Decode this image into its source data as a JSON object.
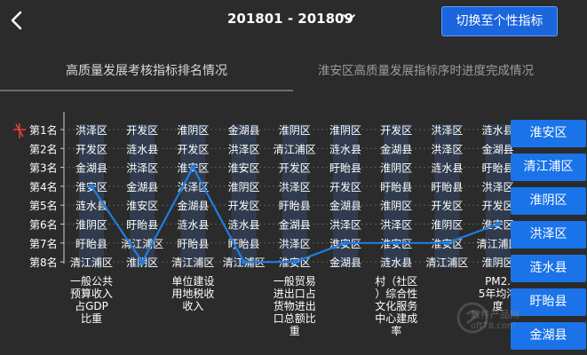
{
  "header": {
    "period": "201801 - 201809",
    "switch_label": "切换至个性指标"
  },
  "tabs": [
    {
      "label": "高质量发展考核指标排名情况",
      "active": true
    },
    {
      "label": "淮安区高质量发展指标序时进度完成情况",
      "active": false
    }
  ],
  "chart_data": {
    "type": "line",
    "rank_labels": [
      "第1名",
      "第2名",
      "第3名",
      "第4名",
      "第5名",
      "第6名",
      "第7名",
      "第8名"
    ],
    "columns": [
      {
        "indicator": "一般公共预算收入占GDP比重",
        "ranking": [
          "洪泽区",
          "开发区",
          "金湖县",
          "淮安区",
          "涟水县",
          "淮阴区",
          "盱眙县",
          "清江浦区"
        ]
      },
      {
        "indicator": "",
        "ranking": [
          "开发区",
          "涟水县",
          "洪泽区",
          "金湖县",
          "淮安区",
          "盱眙县",
          "清江浦区",
          "淮阴区"
        ]
      },
      {
        "indicator": "单位建设用地税收收入",
        "ranking": [
          "淮阴区",
          "开发区",
          "淮安区",
          "洪泽区",
          "金湖县",
          "涟水县",
          "盱眙县",
          "清江浦区"
        ]
      },
      {
        "indicator": "",
        "ranking": [
          "金湖县",
          "洪泽区",
          "淮安区",
          "淮阴区",
          "开发区",
          "涟水县",
          "盱眙县",
          "清江浦区"
        ]
      },
      {
        "indicator": "一般贸易进出口占货物进出口总额比重",
        "ranking": [
          "淮阴区",
          "清江浦区",
          "开发区",
          "洪泽区",
          "盱眙县",
          "金湖县",
          "洪泽区",
          "淮安区"
        ]
      },
      {
        "indicator": "",
        "ranking": [
          "淮阴区",
          "涟水县",
          "盱眙县",
          "开发区",
          "金湖县",
          "洪泽区",
          "淮安区",
          "金湖县"
        ]
      },
      {
        "indicator": "村（社区）综合性文化服务中心建成率",
        "ranking": [
          "开发区",
          "金湖县",
          "淮阴区",
          "盱眙县",
          "淮阴区",
          "洪泽区",
          "淮安区",
          "涟水县"
        ]
      },
      {
        "indicator": "",
        "ranking": [
          "洪泽区",
          "洪泽区",
          "涟水县",
          "盱眙县",
          "开发区",
          "淮阴区",
          "淮安区",
          "清江浦区"
        ]
      },
      {
        "indicator": "PM2.5年均浓度",
        "ranking": [
          "涟水县",
          "金湖县",
          "盱眙县",
          "洪泽区",
          "开发区",
          "淮安区",
          "清江浦区",
          "淮阴区"
        ]
      }
    ],
    "series": [
      {
        "name": "淮安区",
        "ranks": [
          4,
          8,
          3,
          8,
          8,
          7,
          7,
          7,
          6
        ]
      }
    ],
    "line_color": "#1e7de0",
    "ylim": [
      1,
      8
    ]
  },
  "districts": [
    {
      "label": "淮安区",
      "color": "#1a73e8"
    },
    {
      "label": "清江浦区",
      "color": "#1a73e8"
    },
    {
      "label": "淮阴区",
      "color": "#1a73e8"
    },
    {
      "label": "洪泽区",
      "color": "#1a73e8"
    },
    {
      "label": "涟水县",
      "color": "#1a73e8"
    },
    {
      "label": "盱眙县",
      "color": "#1a73e8"
    },
    {
      "label": "金湖县",
      "color": "#1a73e8"
    }
  ],
  "watermark": {
    "text": "软件产品网",
    "subtext": "oft78.com"
  }
}
